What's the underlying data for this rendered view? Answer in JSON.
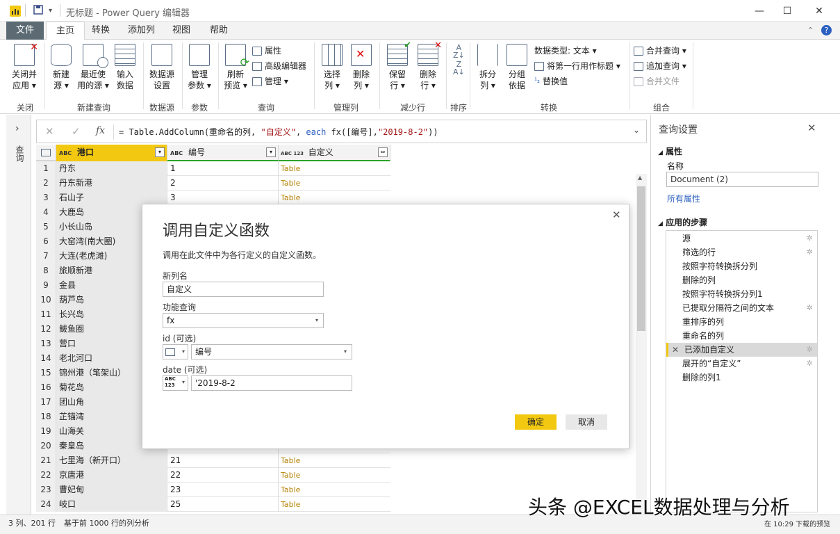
{
  "window": {
    "title": "无标题 - Power Query 编辑器",
    "min": "—",
    "max": "☐",
    "close": "✕"
  },
  "tabs": [
    "文件",
    "主页",
    "转换",
    "添加列",
    "视图",
    "帮助"
  ],
  "ribbon": {
    "close_apply": [
      "关闭并",
      "应用 ▾"
    ],
    "new_source": [
      "新建",
      "源 ▾"
    ],
    "recent_sources": [
      "最近使",
      "用的源 ▾"
    ],
    "enter_data": [
      "输入",
      "数据"
    ],
    "ds_settings": [
      "数据源",
      "设置"
    ],
    "manage_params": [
      "管理",
      "参数 ▾"
    ],
    "refresh_preview": [
      "刷新",
      "预览 ▾"
    ],
    "properties": "属性",
    "advanced_editor": "高级编辑器",
    "manage": "管理 ▾",
    "choose_cols": [
      "选择",
      "列 ▾"
    ],
    "remove_cols": [
      "删除",
      "列 ▾"
    ],
    "keep_rows": [
      "保留",
      "行 ▾"
    ],
    "remove_rows": [
      "删除",
      "行 ▾"
    ],
    "split_col": [
      "拆分",
      "列 ▾"
    ],
    "group_by": [
      "分组",
      "依据"
    ],
    "data_type": "数据类型: 文本 ▾",
    "first_row_header": "将第一行用作标题 ▾",
    "replace_values": "替换值",
    "merge_queries": "合并查询 ▾",
    "append_queries": "追加查询 ▾",
    "combine_files": "合并文件",
    "groups": [
      "关闭",
      "新建查询",
      "数据源",
      "参数",
      "查询",
      "管理列",
      "减少行",
      "排序",
      "转换",
      "组合"
    ]
  },
  "leftnav": {
    "label": "查询"
  },
  "formula": {
    "prefix": "= Table.AddColumn(重命名的列, ",
    "str1": "\"自定义\"",
    "mid": ", ",
    "kw": "each",
    "rest": " fx([编号],",
    "str2": "\"2019-8-2\"",
    "end": "))"
  },
  "table": {
    "headers": [
      "港口",
      "编号",
      "自定义"
    ],
    "type_icons": [
      "ABC",
      "ABC",
      "ABC 123"
    ],
    "rows": [
      {
        "n": "1",
        "port": "丹东",
        "id": "1",
        "custom": "Table"
      },
      {
        "n": "2",
        "port": "丹东新港",
        "id": "2",
        "custom": "Table"
      },
      {
        "n": "3",
        "port": "石山子",
        "id": "3",
        "custom": "Table"
      },
      {
        "n": "4",
        "port": "大鹿岛",
        "id": "",
        "custom": ""
      },
      {
        "n": "5",
        "port": "小长山岛",
        "id": "",
        "custom": ""
      },
      {
        "n": "6",
        "port": "大窑湾(南大圈)",
        "id": "",
        "custom": ""
      },
      {
        "n": "7",
        "port": "大连(老虎滩)",
        "id": "",
        "custom": ""
      },
      {
        "n": "8",
        "port": "旅顺新港",
        "id": "",
        "custom": ""
      },
      {
        "n": "9",
        "port": "金县",
        "id": "",
        "custom": ""
      },
      {
        "n": "10",
        "port": "葫芦岛",
        "id": "",
        "custom": ""
      },
      {
        "n": "11",
        "port": "长兴岛",
        "id": "",
        "custom": ""
      },
      {
        "n": "12",
        "port": "鲅鱼圈",
        "id": "",
        "custom": ""
      },
      {
        "n": "13",
        "port": "营口",
        "id": "",
        "custom": ""
      },
      {
        "n": "14",
        "port": "老北河口",
        "id": "",
        "custom": ""
      },
      {
        "n": "15",
        "port": "锦州港（笔架山）",
        "id": "",
        "custom": ""
      },
      {
        "n": "16",
        "port": "菊花岛",
        "id": "",
        "custom": ""
      },
      {
        "n": "17",
        "port": "团山角",
        "id": "",
        "custom": ""
      },
      {
        "n": "18",
        "port": "芷锚湾",
        "id": "",
        "custom": ""
      },
      {
        "n": "19",
        "port": "山海关",
        "id": "",
        "custom": ""
      },
      {
        "n": "20",
        "port": "秦皇岛",
        "id": "",
        "custom": ""
      },
      {
        "n": "21",
        "port": "七里海（新开口）",
        "id": "21",
        "custom": "Table"
      },
      {
        "n": "22",
        "port": "京唐港",
        "id": "22",
        "custom": "Table"
      },
      {
        "n": "23",
        "port": "曹妃甸",
        "id": "23",
        "custom": "Table"
      },
      {
        "n": "24",
        "port": "岐口",
        "id": "25",
        "custom": "Table"
      }
    ]
  },
  "query_settings": {
    "title": "查询设置",
    "properties_title": "属性",
    "name_label": "名称",
    "name_value": "Document (2)",
    "all_properties": "所有属性",
    "steps_title": "应用的步骤",
    "steps": [
      {
        "label": "源",
        "gear": true
      },
      {
        "label": "筛选的行",
        "gear": true
      },
      {
        "label": "按照字符转换拆分列",
        "gear": false
      },
      {
        "label": "删除的列",
        "gear": false
      },
      {
        "label": "按照字符转换拆分列1",
        "gear": false
      },
      {
        "label": "已提取分隔符之间的文本",
        "gear": true
      },
      {
        "label": "重排序的列",
        "gear": false
      },
      {
        "label": "重命名的列",
        "gear": false
      },
      {
        "label": "已添加自定义",
        "gear": true,
        "selected": true
      },
      {
        "label": "展开的“自定义”",
        "gear": true
      },
      {
        "label": "删除的列1",
        "gear": false
      }
    ]
  },
  "status": {
    "left": "3 列、201 行",
    "mid": "基于前 1000 行的列分析",
    "right": "在 10:29 下载的预览"
  },
  "dialog": {
    "title": "调用自定义函数",
    "desc": "调用在此文件中为各行定义的自定义函数。",
    "newcol_label": "新列名",
    "newcol_value": "自定义",
    "func_label": "功能查询",
    "func_value": "fx",
    "id_label": "id (可选)",
    "id_value": "编号",
    "date_label": "date (可选)",
    "date_value": "'2019-8-2",
    "ok": "确定",
    "cancel": "取消"
  },
  "watermark": "头条 @EXCEL数据处理与分析",
  "colors": {
    "accent_yellow": "#f2c811",
    "green": "#2ba32a",
    "ok_btn": "#f2c811",
    "link": "#2b60c0"
  }
}
